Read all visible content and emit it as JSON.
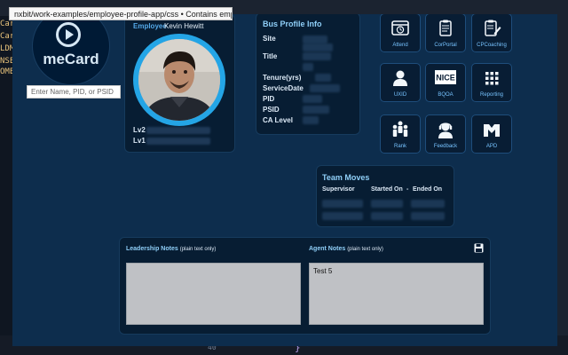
{
  "tooltip": {
    "text": "nxbit/work-examples/employee-profile-app/css • Contains emphasized items"
  },
  "editor": {
    "left_fragments": [
      "Card",
      "Card",
      "LDM",
      "NSE",
      "OME"
    ],
    "line_number": "40",
    "brace": "}"
  },
  "branding": {
    "app_name": "meCard"
  },
  "search": {
    "placeholder": "Enter Name, PID, or PSID"
  },
  "employee": {
    "label": "Employee",
    "name": "Kevin Hewitt",
    "lv2_label": "Lv2",
    "lv1_label": "Lv1"
  },
  "bus_profile": {
    "title": "Bus Profile Info",
    "labels": [
      "Site",
      "Title",
      "Tenure(yrs)",
      "ServiceDate",
      "PID",
      "PSID",
      "CA Level"
    ]
  },
  "tiles": [
    {
      "label": "Attend",
      "icon": "clock-calendar-icon"
    },
    {
      "label": "CorPortal",
      "icon": "clipboard-icon"
    },
    {
      "label": "CPCoaching",
      "icon": "clipboard-pencil-icon"
    },
    {
      "label": "UXID",
      "icon": "user-icon"
    },
    {
      "label": "BQOA",
      "icon": "nice-logo-icon",
      "icon_text": "NICE"
    },
    {
      "label": "Reporting",
      "icon": "grid-icon"
    },
    {
      "label": "Rank",
      "icon": "people-group-icon"
    },
    {
      "label": "Feedback",
      "icon": "headset-agent-icon"
    },
    {
      "label": "APD",
      "icon": "m-logo-icon"
    }
  ],
  "team_moves": {
    "title": "Team Moves",
    "headers": {
      "supervisor": "Supervisor",
      "started": "Started On",
      "separator": "-",
      "ended": "Ended On"
    }
  },
  "notes": {
    "leadership": {
      "title": "Leadership Notes",
      "subtitle": "(plain text only)",
      "value": ""
    },
    "agent": {
      "title": "Agent Notes",
      "subtitle": "(plain text only)",
      "value": "Test 5"
    }
  },
  "colors": {
    "accent": "#24a5e6",
    "panel": "#071d33",
    "background": "#0d2d4d"
  }
}
